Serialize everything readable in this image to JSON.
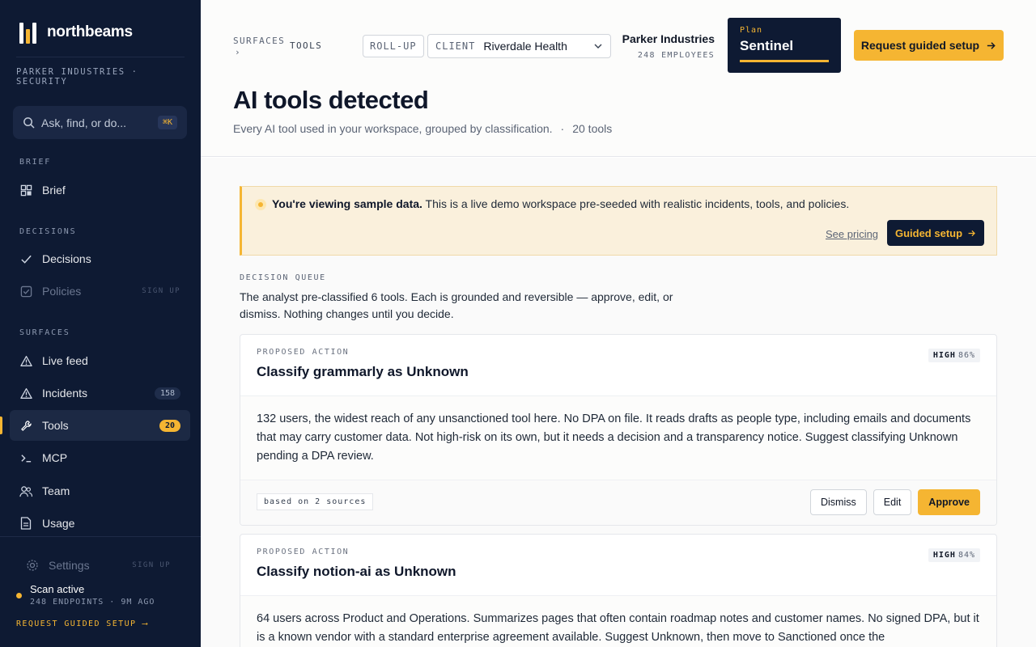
{
  "brand": {
    "name": "northbeams",
    "accent": "#f5b532",
    "navy": "#0e1a33"
  },
  "sidebar": {
    "org_line": "PARKER INDUSTRIES · SECURITY",
    "search": {
      "placeholder": "Ask, find, or do...",
      "shortcut": "⌘K"
    },
    "sections": {
      "brief": "BRIEF",
      "decisions": "DECISIONS",
      "surfaces": "SURFACES"
    },
    "items": {
      "brief": {
        "label": "Brief"
      },
      "decisions": {
        "label": "Decisions"
      },
      "policies": {
        "label": "Policies",
        "tag": "SIGN UP"
      },
      "live_feed": {
        "label": "Live feed"
      },
      "incidents": {
        "label": "Incidents",
        "count": "158"
      },
      "tools": {
        "label": "Tools",
        "count": "20"
      },
      "mcp": {
        "label": "MCP"
      },
      "team": {
        "label": "Team"
      },
      "usage": {
        "label": "Usage"
      },
      "settings": {
        "label": "Settings",
        "tag": "SIGN UP"
      }
    },
    "scan": {
      "title": "Scan active",
      "sub": "248 ENDPOINTS · 9M AGO"
    },
    "cta": "REQUEST GUIDED SETUP ⟶"
  },
  "header": {
    "crumb_surfaces": "SURFACES",
    "crumb_sep": "›",
    "crumb_tools": "TOOLS",
    "rollup": "ROLL-UP",
    "client_label": "CLIENT",
    "client_value": "Riverdale Health",
    "company_name": "Parker Industries",
    "company_sub": "248 EMPLOYEES",
    "plan_label": "Plan",
    "plan_value": "Sentinel",
    "request_button": "Request guided setup",
    "title": "AI tools detected",
    "subtitle": "Every AI tool used in your workspace, grouped by classification.",
    "subtitle_dot": "·",
    "tool_count": "20 tools"
  },
  "banner": {
    "bold": "You're viewing sample data.",
    "text": " This is a live demo workspace pre-seeded with realistic incidents, tools, and policies.",
    "link": "See pricing",
    "button": "Guided setup"
  },
  "queue": {
    "label": "DECISION QUEUE",
    "description": "The analyst pre-classified 6 tools. Each is grounded and reversible — approve, edit, or dismiss. Nothing changes until you decide."
  },
  "cards": [
    {
      "kicker": "PROPOSED ACTION",
      "title": "Classify grammarly as Unknown",
      "level": "HIGH",
      "pct": "86%",
      "body": "132 users, the widest reach of any unsanctioned tool here. No DPA on file. It reads drafts as people type, including emails and documents that may carry customer data. Not high-risk on its own, but it needs a decision and a transparency notice. Suggest classifying Unknown pending a DPA review.",
      "sources": "based on 2 sources",
      "dismiss": "Dismiss",
      "edit": "Edit",
      "approve": "Approve"
    },
    {
      "kicker": "PROPOSED ACTION",
      "title": "Classify notion-ai as Unknown",
      "level": "HIGH",
      "pct": "84%",
      "body": "64 users across Product and Operations. Summarizes pages that often contain roadmap notes and customer names. No signed DPA, but it is a known vendor with a standard enterprise agreement available. Suggest Unknown, then move to Sanctioned once the"
    }
  ]
}
